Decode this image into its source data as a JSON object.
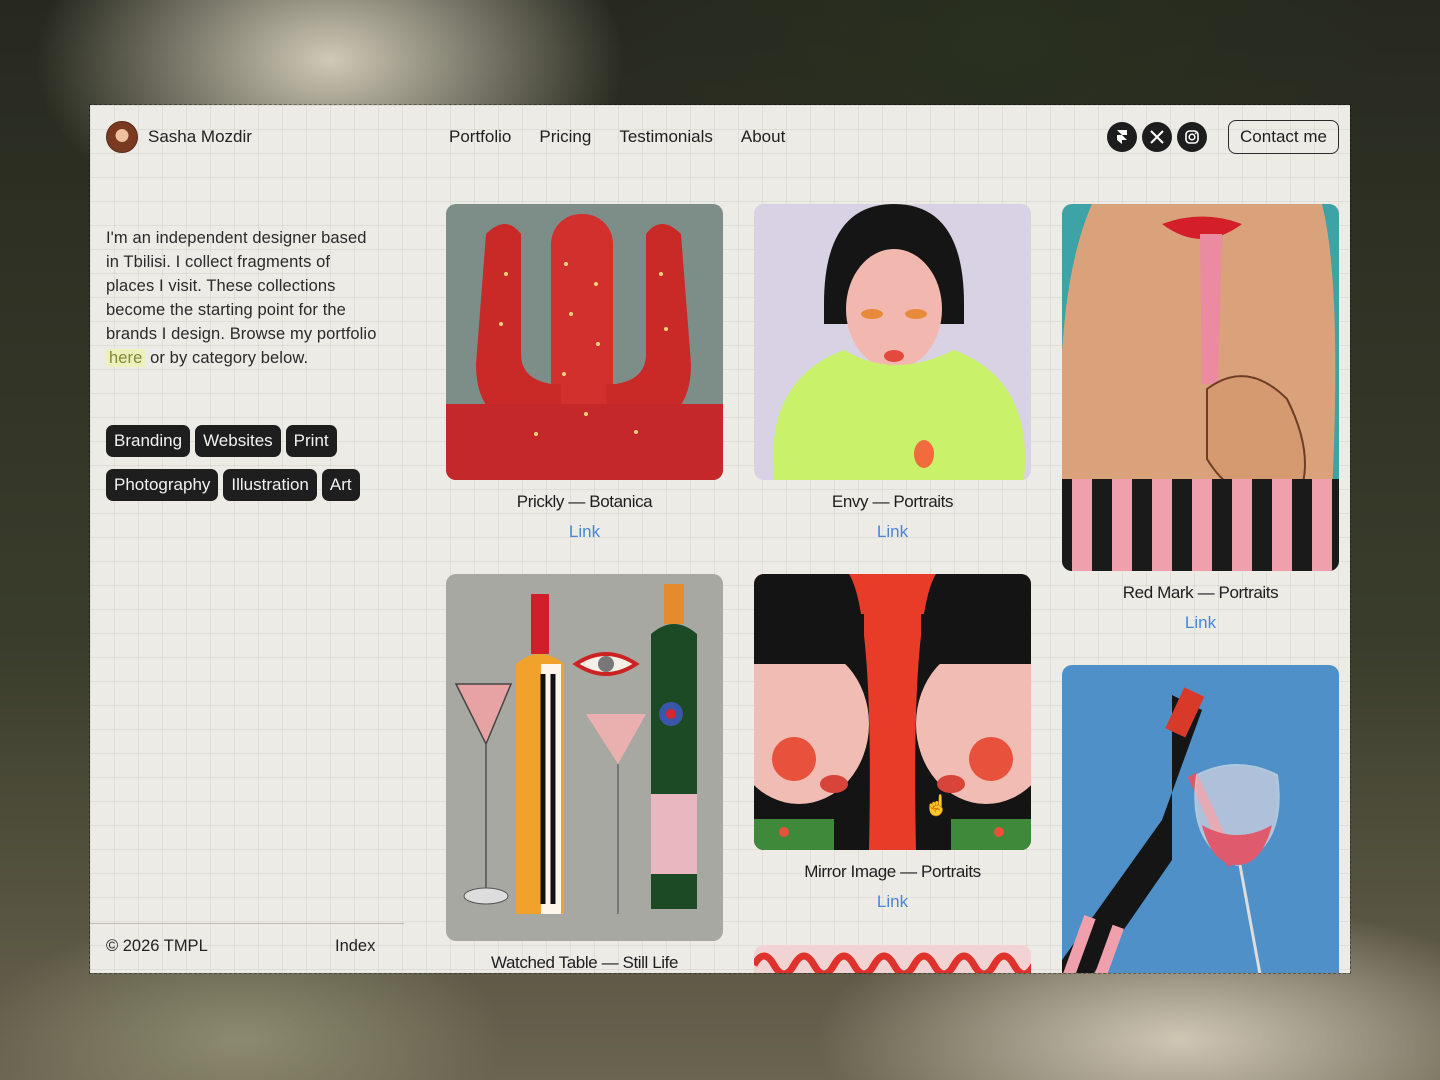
{
  "header": {
    "name": "Sasha Mozdir",
    "nav": [
      "Portfolio",
      "Pricing",
      "Testimonials",
      "About"
    ],
    "social_icons": [
      "framer-icon",
      "x-icon",
      "instagram-icon"
    ],
    "contact_label": "Contact me"
  },
  "intro": {
    "text_before": "I'm an independent designer based in Tbilisi. I collect fragments of places I visit. These collections become the starting point for the brands I design. Browse my portfolio ",
    "link_text": "here",
    "text_after": " or by category below."
  },
  "categories": [
    "Branding",
    "Websites",
    "Print",
    "Photography",
    "Illustration",
    "Art"
  ],
  "footer": {
    "copyright": "© 2026 TMPL",
    "index_label": "Index"
  },
  "works": [
    {
      "title": "Prickly — Botanica",
      "link": "Link"
    },
    {
      "title": "Envy — Portraits",
      "link": "Link"
    },
    {
      "title": "Red Mark — Portraits",
      "link": "Link"
    },
    {
      "title": "Watched Table — Still Life",
      "link": ""
    },
    {
      "title": "Mirror Image — Portraits",
      "link": "Link"
    }
  ],
  "colors": {
    "page_bg": "#edebe6",
    "tag_bg": "#1e1e1e",
    "link": "#4a86d6",
    "highlight_bg": "#eef0bc"
  }
}
